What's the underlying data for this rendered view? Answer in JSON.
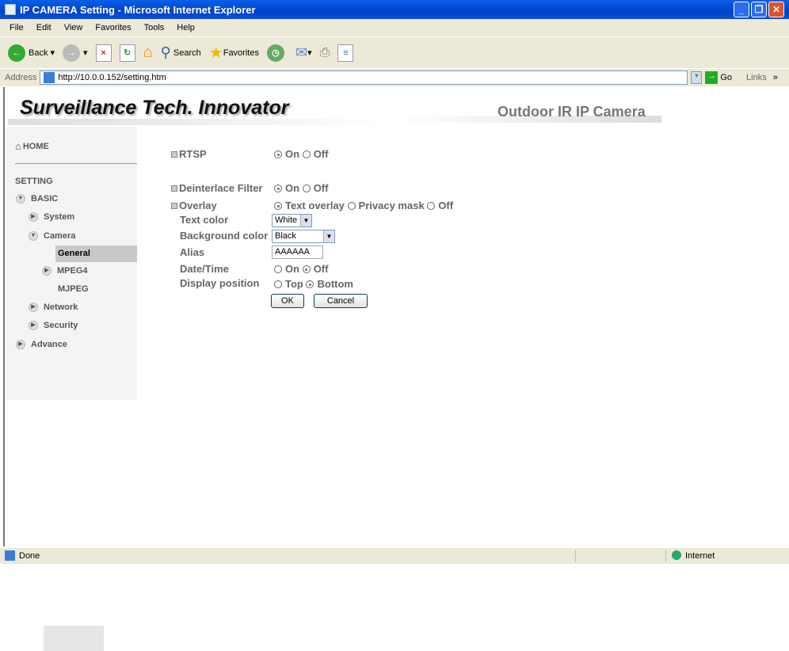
{
  "window": {
    "title": "IP CAMERA Setting - Microsoft Internet Explorer"
  },
  "menu": [
    "File",
    "Edit",
    "View",
    "Favorites",
    "Tools",
    "Help"
  ],
  "toolbar": {
    "back": "Back",
    "search": "Search",
    "favorites": "Favorites"
  },
  "address": {
    "label": "Address",
    "url": "http://10.0.0.152/setting.htm",
    "go": "Go",
    "links": "Links"
  },
  "header": {
    "brand": "Surveillance Tech. Innovator",
    "product": "Outdoor IR IP Camera"
  },
  "sidebar": {
    "home": "HOME",
    "setting": "SETTING",
    "basic": "BASIC",
    "system": "System",
    "camera": "Camera",
    "general": "General",
    "mpeg4": "MPEG4",
    "mjpeg": "MJPEG",
    "network": "Network",
    "security": "Security",
    "advance": "Advance"
  },
  "form": {
    "rtsp": {
      "label": "RTSP",
      "on": "On",
      "off": "Off",
      "value": "On"
    },
    "deinterlace": {
      "label": "Deinterlace Filter",
      "on": "On",
      "off": "Off",
      "value": "On"
    },
    "overlay": {
      "label": "Overlay",
      "text": "Text overlay",
      "privacy": "Privacy mask",
      "off": "Off",
      "value": "Text overlay"
    },
    "text_color": {
      "label": "Text color",
      "value": "White"
    },
    "bg_color": {
      "label": "Background color",
      "value": "Black"
    },
    "alias": {
      "label": "Alias",
      "value": "AAAAAA"
    },
    "datetime": {
      "label": "Date/Time",
      "on": "On",
      "off": "Off",
      "value": "Off"
    },
    "position": {
      "label": "Display position",
      "top": "Top",
      "bottom": "Bottom",
      "value": "Bottom"
    },
    "ok": "OK",
    "cancel": "Cancel"
  },
  "status": {
    "text": "Done",
    "zone": "Internet"
  }
}
